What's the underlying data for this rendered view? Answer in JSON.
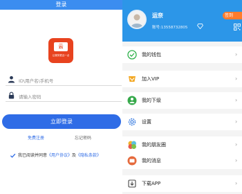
{
  "login": {
    "header_title": "登录",
    "logo_char": "云",
    "logo_caption": "让服务更近一点",
    "user_placeholder": "ID\\用户名\\手机号",
    "password_placeholder": "请输入密码",
    "login_button": "立即登录",
    "register_link": "免费注册",
    "forgot_link": "忘记密码",
    "agree_prefix": "我已阅读并同意",
    "user_agreement": "《用户协议》",
    "agree_and": "及",
    "privacy_policy": "《隐私条款》",
    "accent_color": "#2f6ce6"
  },
  "profile": {
    "username": "运奈",
    "account": "账号:13558732805",
    "badge": "签到",
    "header_color": "#2c96e8",
    "menu": [
      {
        "label": "我的钱包",
        "icon": "wallet-icon"
      },
      {
        "label": "加入VIP",
        "icon": "vip-icon"
      },
      {
        "label": "我的下级",
        "icon": "subordinates-icon"
      },
      {
        "label": "设置",
        "icon": "settings-gear-icon"
      },
      {
        "label": "我的朋友圈",
        "icon": "moments-icon"
      },
      {
        "label": "我的消息",
        "icon": "message-icon"
      },
      {
        "label": "下载APP",
        "icon": "download-icon"
      }
    ],
    "chevron": "›"
  }
}
